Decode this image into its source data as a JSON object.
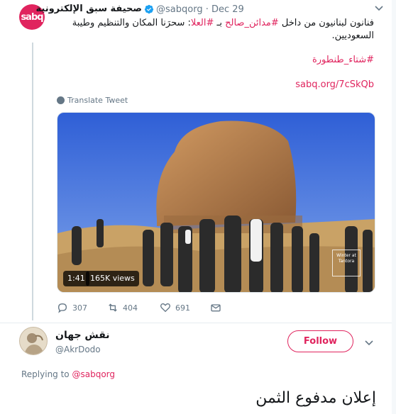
{
  "tweet": {
    "author_name": "صحيفة سبق الإلكترونية",
    "handle": "@sabqorg",
    "separator": "·",
    "date": "Dec 29",
    "text_part1": "فنانون لبنانيون من داخل ",
    "hashtag1": "#مدائن_صالح",
    "text_part2": " بـ ",
    "hashtag2": "#العلا",
    "text_part3": ": سحرَنا المكان والتنظيم وطيبة السعوديين.",
    "hashtag3": "#شتاء_طنطورة",
    "link": "sabq.org/7cSkQb",
    "translate_label": "Translate Tweet",
    "video": {
      "duration": "1:41",
      "views": "165K views",
      "watermark": "Winter at Tantora"
    },
    "actions": {
      "replies": "307",
      "retweets": "404",
      "likes": "691"
    }
  },
  "reply": {
    "author_name": "نقش جهان",
    "handle": "@AkrDodo",
    "follow_label": "Follow",
    "replying_to_label": "Replying to",
    "replying_to_handle": "@sabqorg",
    "text": "إعلان مدفوع الثمن"
  },
  "colors": {
    "accent": "#e0245e",
    "muted": "#657786",
    "verified": "#1da1f2"
  }
}
